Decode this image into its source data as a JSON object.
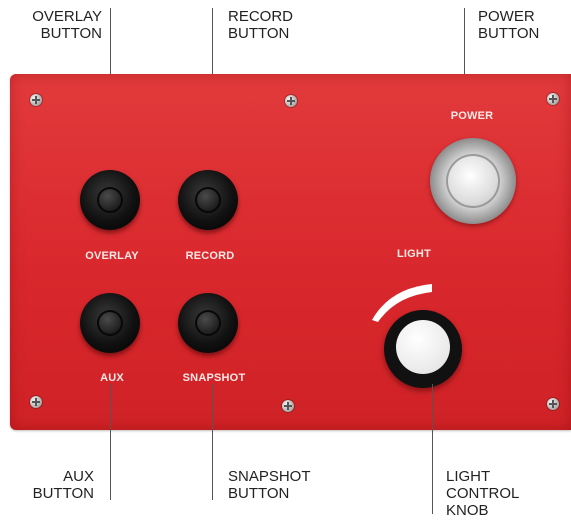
{
  "callouts": {
    "overlay": "OVERLAY\nBUTTON",
    "record": "RECORD\nBUTTON",
    "power": "POWER\nBUTTON",
    "aux": "AUX\nBUTTON",
    "snapshot": "SNAPSHOT\nBUTTON",
    "light_knob": "LIGHT\nCONTROL\nKNOB"
  },
  "panel_labels": {
    "power": "POWER",
    "light": "LIGHT",
    "overlay": "OVERLAY",
    "record": "RECORD",
    "aux": "AUX",
    "snapshot": "SNAPSHOT"
  },
  "colors": {
    "panel_red": "#d9282d",
    "button_black": "#111111",
    "power_metal": "#cfcfcf",
    "knob_white": "#f2f2f2"
  }
}
